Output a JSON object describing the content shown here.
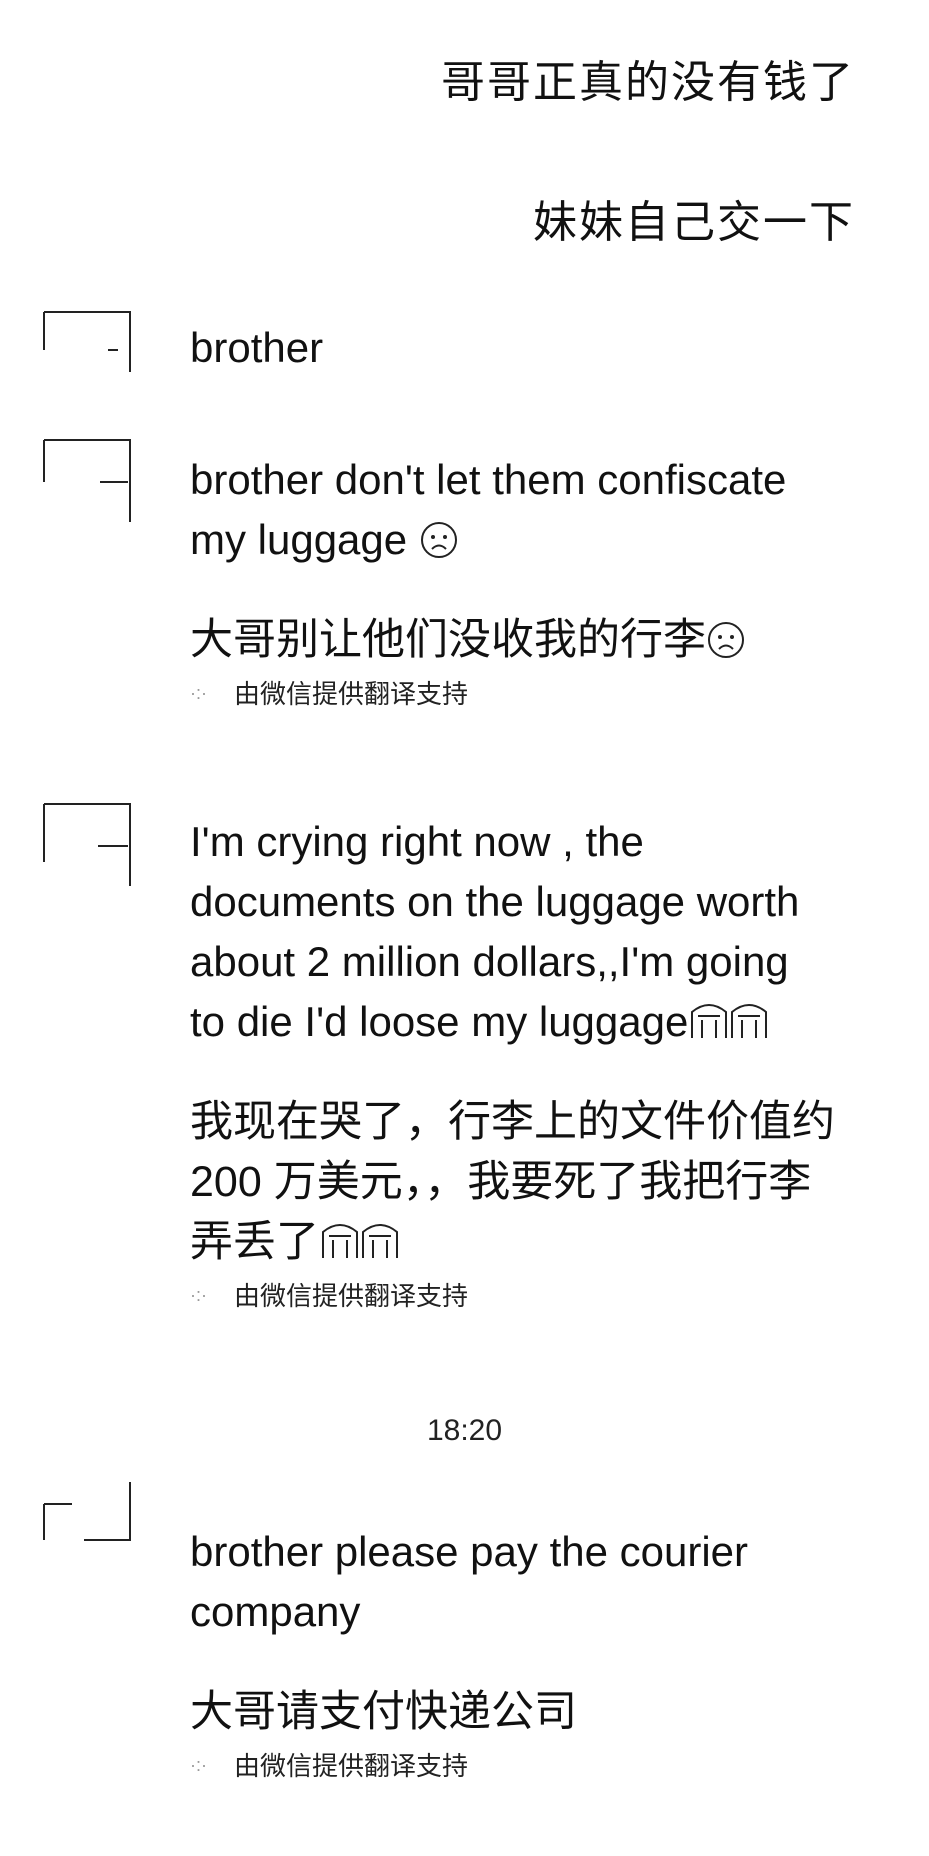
{
  "sent_messages": [
    "哥哥正真的没有钱了",
    "妹妹自己交一下"
  ],
  "received": [
    {
      "text": "brother"
    },
    {
      "text": "brother don't let them confiscate\nmy luggage",
      "text_emoji": "sad-face",
      "translation": "大哥别让他们没收我的行李",
      "translation_emoji": "sad-face",
      "credit": "由微信提供翻译支持"
    },
    {
      "text": "I'm crying right now , the\ndocuments on the luggage worth\nabout 2 million dollars,,I'm going\nto die I'd loose my luggage",
      "text_emoji": "crying-face x2",
      "translation": "我现在哭了，行李上的文件价值约\n200 万美元，，我要死了我把行李\n弄丢了",
      "translation_emoji": "crying-face x2",
      "credit": "由微信提供翻译支持"
    },
    {
      "text": "brother please pay the courier\ncompany",
      "translation": "大哥请支付快递公司",
      "credit": "由微信提供翻译支持"
    }
  ],
  "timestamp": "18:20"
}
